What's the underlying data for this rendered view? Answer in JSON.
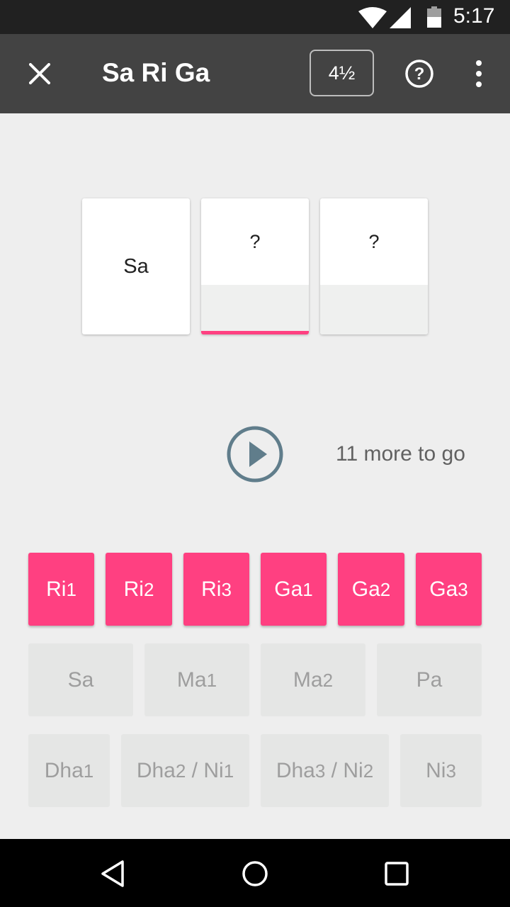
{
  "status_bar": {
    "time": "5:17",
    "icons": [
      "wifi-icon",
      "cell-signal-icon",
      "battery-icon"
    ]
  },
  "app_bar": {
    "title": "Sa Ri Ga",
    "level_label": "4½",
    "icons": [
      "close-icon",
      "help-icon",
      "more-vert-icon"
    ]
  },
  "cards": [
    {
      "label": "Sa",
      "state": "known"
    },
    {
      "label": "?",
      "state": "active"
    },
    {
      "label": "?",
      "state": "unknown"
    }
  ],
  "progress": {
    "remaining_text": "11 more to go"
  },
  "colors": {
    "accent": "#ff4081",
    "app_bar": "#434343",
    "play": "#607d8b",
    "background": "#eeeeee",
    "disabled_button": "#e5e6e5"
  },
  "answers": {
    "row1": [
      {
        "base": "Ri",
        "sub": "1",
        "enabled": true
      },
      {
        "base": "Ri",
        "sub": "2",
        "enabled": true
      },
      {
        "base": "Ri",
        "sub": "3",
        "enabled": true
      },
      {
        "base": "Ga",
        "sub": "1",
        "enabled": true
      },
      {
        "base": "Ga",
        "sub": "2",
        "enabled": true
      },
      {
        "base": "Ga",
        "sub": "3",
        "enabled": true
      }
    ],
    "row2": [
      {
        "base": "Sa",
        "sub": "",
        "enabled": false
      },
      {
        "base": "Ma",
        "sub": "1",
        "enabled": false
      },
      {
        "base": "Ma",
        "sub": "2",
        "enabled": false
      },
      {
        "base": "Pa",
        "sub": "",
        "enabled": false
      }
    ],
    "row3": [
      {
        "base": "Dha",
        "sub": "1",
        "enabled": false
      },
      {
        "base": "Dha",
        "sub": "2",
        "base2": " / Ni",
        "sub2": "1",
        "enabled": false
      },
      {
        "base": "Dha",
        "sub": "3",
        "base2": " / Ni",
        "sub2": "2",
        "enabled": false
      },
      {
        "base": "Ni",
        "sub": "3",
        "enabled": false
      }
    ]
  },
  "nav_bar": {
    "icons": [
      "back-icon",
      "home-icon",
      "recents-icon"
    ]
  }
}
